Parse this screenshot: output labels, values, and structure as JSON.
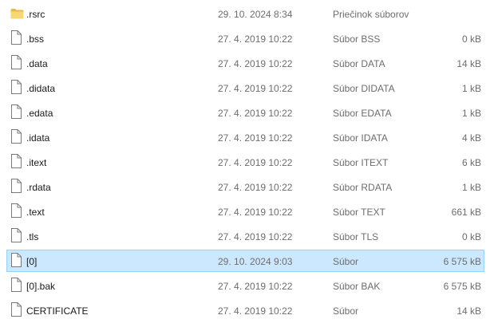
{
  "files": [
    {
      "name": ".rsrc",
      "modified": "29. 10. 2024 8:34",
      "type": "Priečinok súborov",
      "size": "",
      "icon": "folder-icon"
    },
    {
      "name": ".bss",
      "modified": "27. 4. 2019 10:22",
      "type": "Súbor BSS",
      "size": "0 kB",
      "icon": "file-icon"
    },
    {
      "name": ".data",
      "modified": "27. 4. 2019 10:22",
      "type": "Súbor DATA",
      "size": "14 kB",
      "icon": "file-icon"
    },
    {
      "name": ".didata",
      "modified": "27. 4. 2019 10:22",
      "type": "Súbor DIDATA",
      "size": "1 kB",
      "icon": "file-icon"
    },
    {
      "name": ".edata",
      "modified": "27. 4. 2019 10:22",
      "type": "Súbor EDATA",
      "size": "1 kB",
      "icon": "file-icon"
    },
    {
      "name": ".idata",
      "modified": "27. 4. 2019 10:22",
      "type": "Súbor IDATA",
      "size": "4 kB",
      "icon": "file-icon"
    },
    {
      "name": ".itext",
      "modified": "27. 4. 2019 10:22",
      "type": "Súbor ITEXT",
      "size": "6 kB",
      "icon": "file-icon"
    },
    {
      "name": ".rdata",
      "modified": "27. 4. 2019 10:22",
      "type": "Súbor RDATA",
      "size": "1 kB",
      "icon": "file-icon"
    },
    {
      "name": ".text",
      "modified": "27. 4. 2019 10:22",
      "type": "Súbor TEXT",
      "size": "661 kB",
      "icon": "file-icon"
    },
    {
      "name": ".tls",
      "modified": "27. 4. 2019 10:22",
      "type": "Súbor TLS",
      "size": "0 kB",
      "icon": "file-icon"
    },
    {
      "name": "[0]",
      "modified": "29. 10. 2024 9:03",
      "type": "Súbor",
      "size": "6 575 kB",
      "icon": "file-icon",
      "selected": true
    },
    {
      "name": "[0].bak",
      "modified": "27. 4. 2019 10:22",
      "type": "Súbor BAK",
      "size": "6 575 kB",
      "icon": "file-icon"
    },
    {
      "name": "CERTIFICATE",
      "modified": "27. 4. 2019 10:22",
      "type": "Súbor",
      "size": "14 kB",
      "icon": "file-icon"
    }
  ],
  "colors": {
    "selection_bg": "#cce8ff",
    "selection_border": "#99d1ff",
    "folder": "#f8d775",
    "secondary_text": "#6d6d6d"
  }
}
